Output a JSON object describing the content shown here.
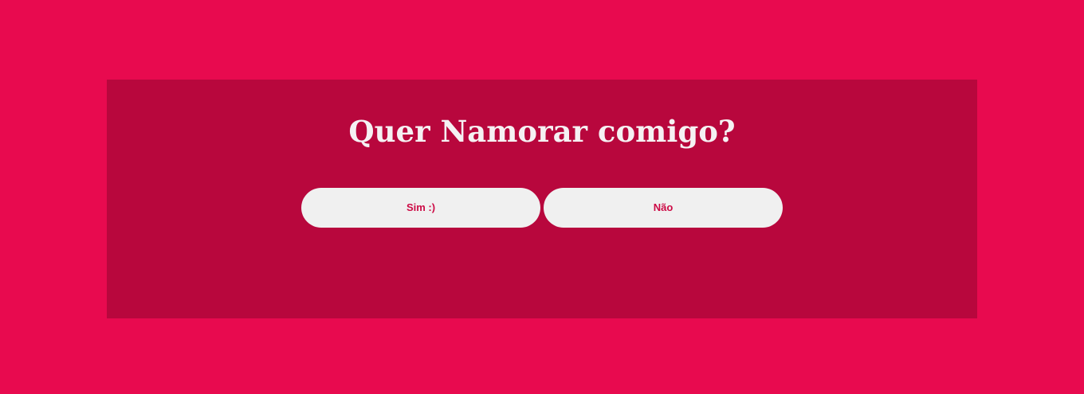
{
  "question": "Quer Namorar comigo?",
  "buttons": {
    "yes_label": "Sim :)",
    "no_label": "Não"
  },
  "colors": {
    "page_background": "#e80a4f",
    "card_background": "#b8073d",
    "title_text": "#f5f1f3",
    "button_background": "#f0f0f0",
    "button_text": "#cc0a45"
  }
}
